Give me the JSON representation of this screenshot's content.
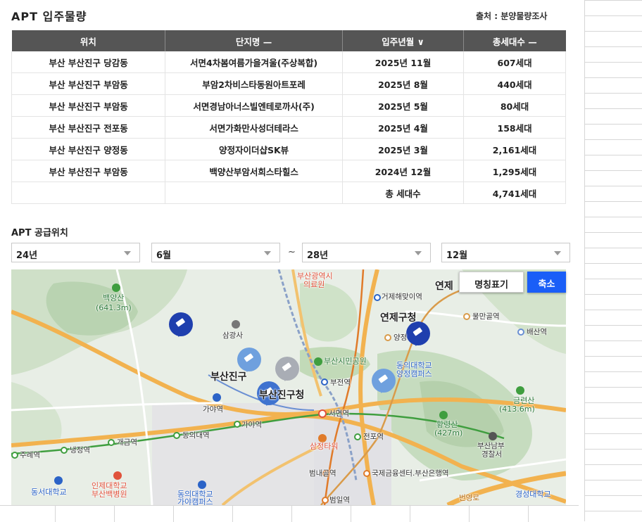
{
  "header": {
    "title": "APT 입주물량",
    "source": "출처 : 분양물량조사"
  },
  "table": {
    "headers": [
      "위치",
      "단지명 —",
      "입주년월 ∨",
      "총세대수 —"
    ],
    "rows": [
      [
        "부산 부산진구 당감동",
        "서면4차봄여름가을겨울(주상복합)",
        "2025년 11월",
        "607세대"
      ],
      [
        "부산 부산진구 부암동",
        "부암2차비스타동원아트포레",
        "2025년 8월",
        "440세대"
      ],
      [
        "부산 부산진구 부암동",
        "서면경남아너스빌엔테로까사(주)",
        "2025년 5월",
        "80세대"
      ],
      [
        "부산 부산진구 전포동",
        "서면가화만사성더테라스",
        "2025년 4월",
        "158세대"
      ],
      [
        "부산 부산진구 양정동",
        "양정자이더샵SK뷰",
        "2025년 3월",
        "2,161세대"
      ],
      [
        "부산 부산진구 부암동",
        "백양산부암서희스타힐스",
        "2024년 12월",
        "1,295세대"
      ]
    ],
    "total": {
      "label": "총 세대수",
      "value": "4,741세대"
    }
  },
  "supply": {
    "title": "APT 공급위치",
    "from_year": "24년",
    "from_month": "6월",
    "separator": "~",
    "to_year": "28년",
    "to_month": "12월"
  },
  "map": {
    "label_toggle": "명칭표기",
    "zoom_button": "축소",
    "labels": {
      "baekyangsan": "백양산",
      "baekyangsan_h": "(641.3m)",
      "samgwangsa": "삼광사",
      "busanjingu_area": "부산진구",
      "busanjingu_office": "부산진구청",
      "yeonje_office": "연제구청",
      "yeonje": "연제",
      "citizens_park": "부산시민공원",
      "dongeui_yangjeong": "동의대학교",
      "yangjeong_campus": "양정캠퍼스",
      "gaya_station": "가야역",
      "gaya_station2": "가야역",
      "dongeui_station": "동의대역",
      "gaegeum_station": "개금역",
      "naengjeong_station": "냉정역",
      "jurye_station": "주례역",
      "seomyeon_station": "서면역",
      "jeonpo_station": "전포역",
      "bujeon_station": "부전역",
      "bumnaegol_station": "범내골역",
      "beomil_station": "범일역",
      "geojae_station": "거제해맞이역",
      "mulmangol_station": "물만골역",
      "baesan_station": "배산역",
      "yangjeong_station": "양정",
      "ifc_station": "국제금융센터.부산은행역",
      "samjeong_tower": "삼정타워",
      "hwangnyeongsan": "황령산",
      "hwangnyeongsan_h": "(427m)",
      "geumnyeonsan": "금련산",
      "geumnyeonsan_h": "(413.6m)",
      "busan_nambu_police": "부산남부",
      "police_station": "경찰서",
      "inje_univ": "인제대학교",
      "baek_hospital": "부산백병원",
      "dongseo_univ": "동서대학교",
      "dongeui_gaya": "동의대학교",
      "gaya_campus": "가야캠퍼스",
      "busan_medical": "부산광역시",
      "busan_medical2": "의료원",
      "kyungsung_univ": "경성대학교",
      "beonyeong_road": "번영로"
    }
  }
}
